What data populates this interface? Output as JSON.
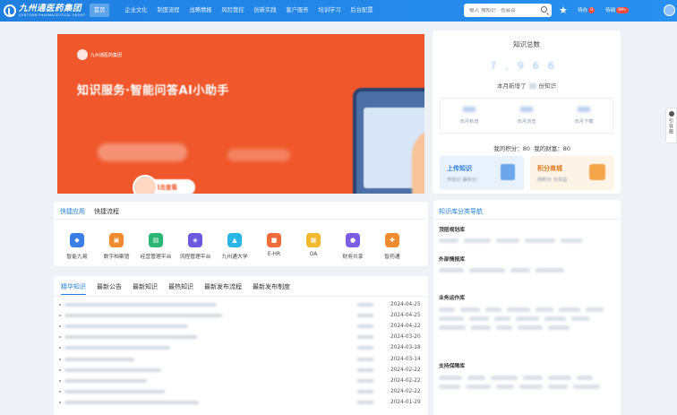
{
  "brand": {
    "name": "九州通医药集团",
    "sub": "JOINTOWN PHARMACEUTICAL GROUP"
  },
  "nav": {
    "items": [
      "首页",
      "企业文化",
      "制度流程",
      "战略情报",
      "风险管控",
      "创新实践",
      "客户服务",
      "培训学习",
      "后台配置"
    ],
    "active": 0
  },
  "search": {
    "placeholder": "输入 搜知识 · 查会议"
  },
  "header": {
    "todo_label": "待办",
    "todo_count": "0",
    "pending_label": "待阅",
    "pending_count": "99+"
  },
  "banner": {
    "logo_text": "九州通医药集团",
    "title": "知识服务·智能问答AI小助手",
    "button": "点击查看"
  },
  "stats": {
    "title": "知识总数",
    "total": "7,966",
    "monthly_prefix": "本月新增了",
    "monthly_suffix": "份知识",
    "metrics": [
      {
        "label": "本月新增"
      },
      {
        "label": "本月浏览"
      },
      {
        "label": "本月下载"
      }
    ],
    "points_label": "我的积分：",
    "points_value": "80",
    "wealth_label": "我的财富：",
    "wealth_value": "80",
    "upload": {
      "title": "上传知识",
      "sub": "传知识 赢积分"
    },
    "mall": {
      "title": "积分商城",
      "sub": "用积分 兑奖品"
    }
  },
  "quick": {
    "tabs": [
      "快捷应用",
      "快捷流程"
    ],
    "active": 0,
    "apps": [
      {
        "label": "智能九易",
        "color": "#3b7fe6",
        "glyph": "◆"
      },
      {
        "label": "数字档案馆",
        "color": "#f08a2e",
        "glyph": "▣"
      },
      {
        "label": "经营管理平台",
        "color": "#2bb673",
        "glyph": "▤"
      },
      {
        "label": "流程管理平台",
        "color": "#6d58e0",
        "glyph": "◈"
      },
      {
        "label": "九州通大学",
        "color": "#2bb5e6",
        "glyph": "▲"
      },
      {
        "label": "E-HR",
        "color": "#f06a3c",
        "glyph": "■"
      },
      {
        "label": "OA",
        "color": "#f0b92e",
        "glyph": "▦"
      },
      {
        "label": "财务共享",
        "color": "#7c5ee6",
        "glyph": "●"
      },
      {
        "label": "智药通",
        "color": "#f08a2e",
        "glyph": "✚"
      }
    ]
  },
  "news": {
    "tabs": [
      "精华知识",
      "最新公告",
      "最新知识",
      "最热知识",
      "最新发布流程",
      "最新发布制度"
    ],
    "active": 0,
    "dates": [
      "2024-04-25",
      "2024-04-25",
      "2024-04-22",
      "2024-03-20",
      "2024-03-18",
      "2024-03-14",
      "2024-02-22",
      "2024-02-22",
      "2024-02-22",
      "2024-01-29"
    ]
  },
  "knav": {
    "title": "知识库分类导航",
    "cats": [
      "顶层规划库",
      "外部情报库",
      "业务运作库",
      "支持保障库"
    ]
  },
  "sidetab": {
    "label": "引导图"
  }
}
